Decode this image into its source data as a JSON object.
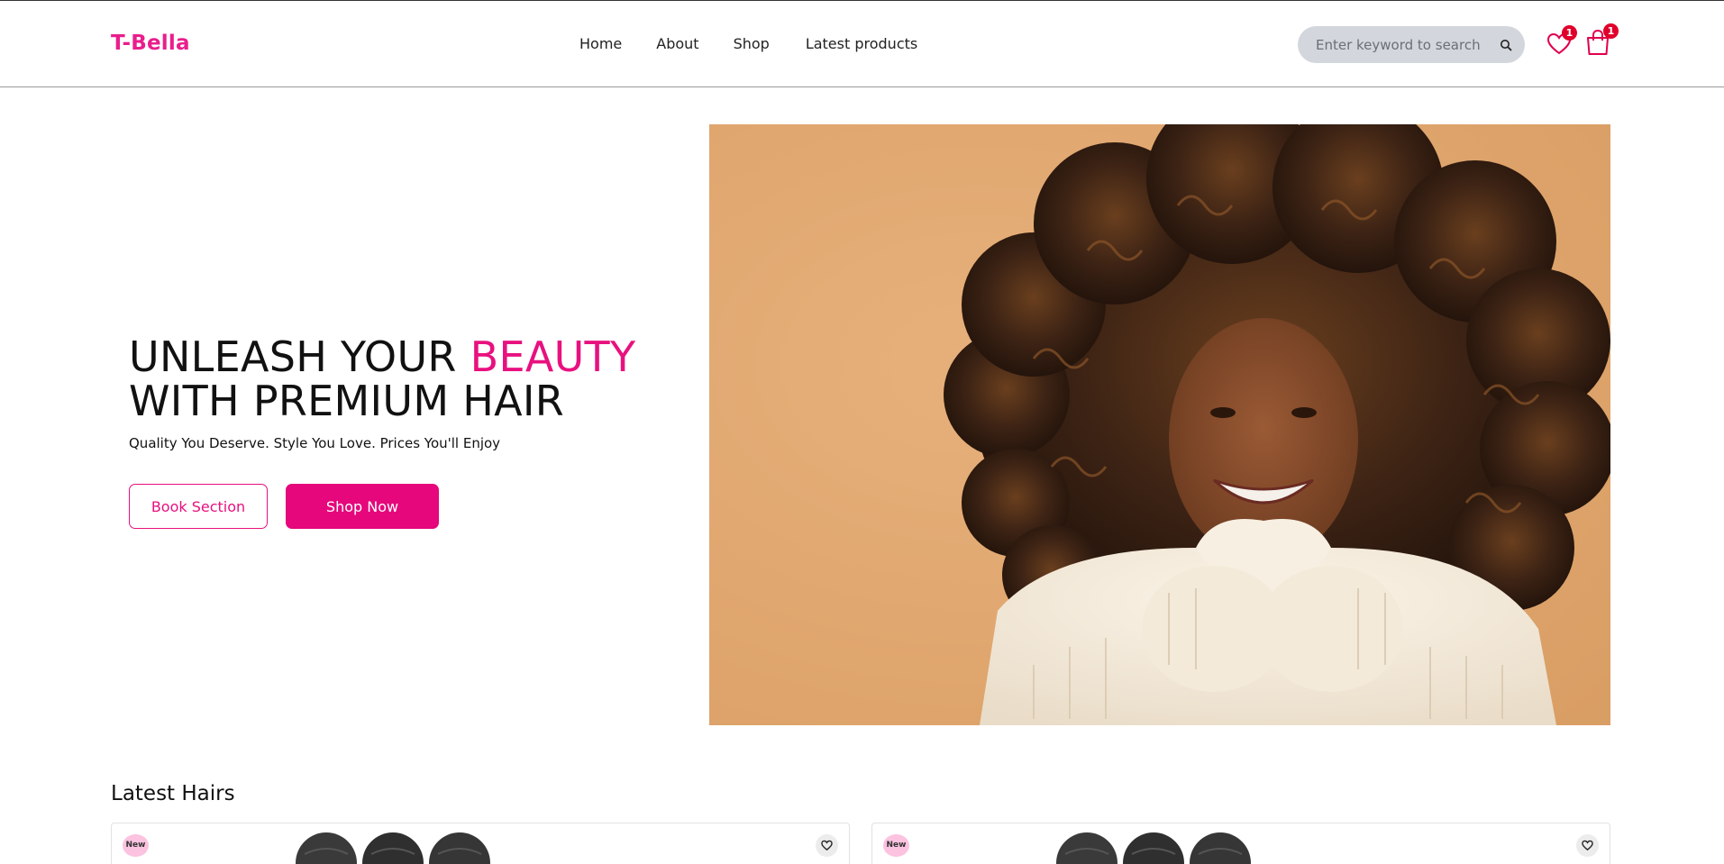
{
  "header": {
    "logo": "T-Bella",
    "nav": [
      "Home",
      "About",
      "Shop",
      "Latest products"
    ],
    "search_placeholder": "Enter keyword to search",
    "wishlist_count": "1",
    "cart_count": "1"
  },
  "hero": {
    "title_part1": "UNLEASH YOUR ",
    "title_accent": "BEAUTY",
    "title_line2": "WITH PREMIUM HAIR",
    "subtitle": "Quality You Deserve. Style You Love. Prices You'll Enjoy",
    "book_button": "Book Section",
    "shop_button": "Shop Now"
  },
  "latest": {
    "title": "Latest Hairs",
    "cards": [
      {
        "badge": "New"
      },
      {
        "badge": "New"
      }
    ]
  },
  "colors": {
    "brand": "#e91e8c",
    "button": "#e5077b",
    "hero_bg": "#dea46c"
  },
  "icons": [
    "search-icon",
    "heart-icon",
    "shopping-bag-icon"
  ]
}
